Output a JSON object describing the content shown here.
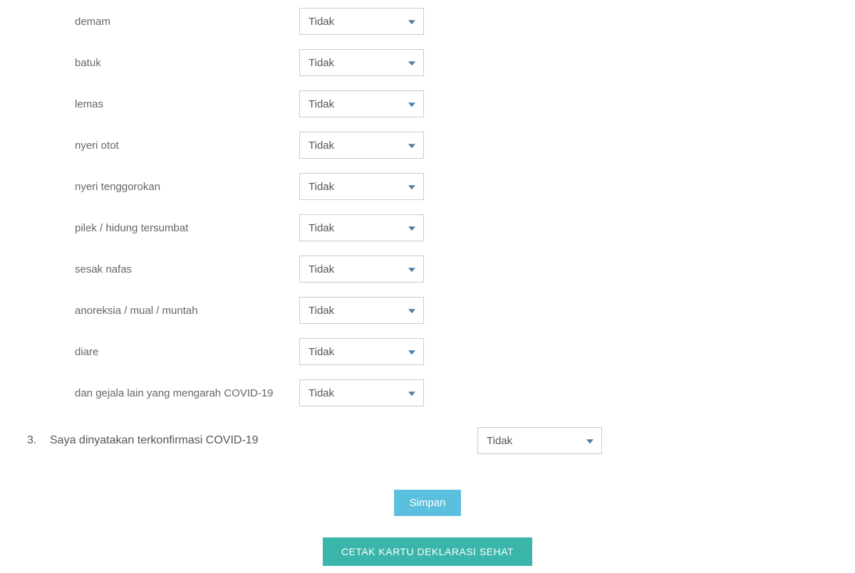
{
  "symptoms": [
    {
      "label": "demam",
      "value": "Tidak"
    },
    {
      "label": "batuk",
      "value": "Tidak"
    },
    {
      "label": "lemas",
      "value": "Tidak"
    },
    {
      "label": "nyeri otot",
      "value": "Tidak"
    },
    {
      "label": "nyeri tenggorokan",
      "value": "Tidak"
    },
    {
      "label": "pilek / hidung tersumbat",
      "value": "Tidak"
    },
    {
      "label": "sesak nafas",
      "value": "Tidak"
    },
    {
      "label": "anoreksia / mual / muntah",
      "value": "Tidak"
    },
    {
      "label": "diare",
      "value": "Tidak"
    },
    {
      "label": "dan gejala lain yang mengarah COVID-19",
      "value": "Tidak"
    }
  ],
  "question3": {
    "number": "3.",
    "text": "Saya dinyatakan terkonfirmasi COVID-19",
    "value": "Tidak"
  },
  "buttons": {
    "simpan": "Simpan",
    "cetak": "CETAK KARTU DEKLARASI SEHAT"
  }
}
